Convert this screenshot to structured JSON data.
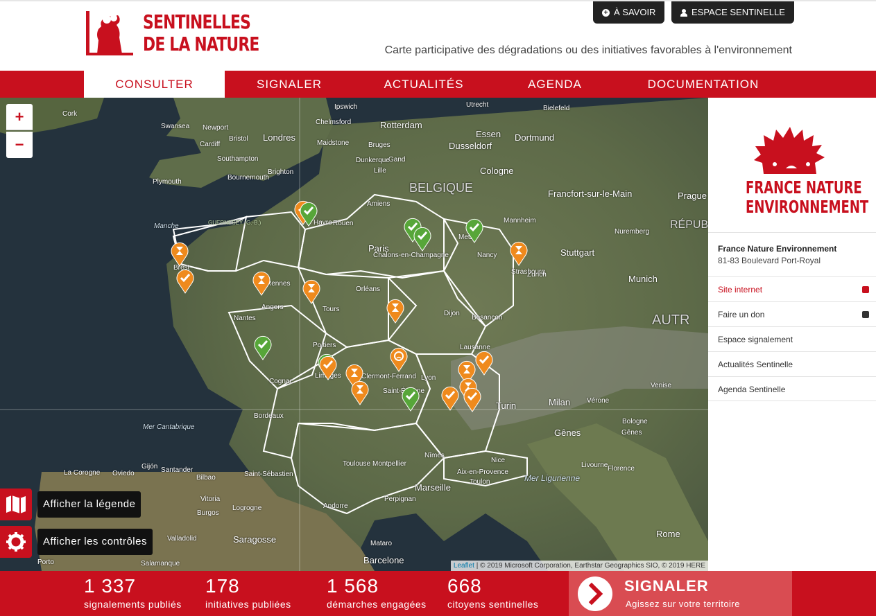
{
  "header": {
    "logo_line1": "SENTINELLES",
    "logo_line2": "DE LA NATURE",
    "btn_about": "À SAVOIR",
    "btn_space": "ESPACE SENTINELLE",
    "tagline": "Carte participative des dégradations ou des initiatives favorables à l'environnement"
  },
  "nav": {
    "items": [
      {
        "label": "CONSULTER"
      },
      {
        "label": "SIGNALER"
      },
      {
        "label": "ACTUALITÉS"
      },
      {
        "label": "AGENDA"
      },
      {
        "label": "DOCUMENTATION"
      }
    ]
  },
  "map": {
    "zoom_in": "+",
    "zoom_out": "−",
    "legend_btn": "Afficher la légende",
    "controls_btn": "Afficher les contrôles",
    "attribution_link": "Leaflet",
    "attribution_text": " | © 2019 Microsoft Corporation, Earthstar Geographics SIO, © 2019 HERE",
    "labels": [
      "Cork",
      "Swansea",
      "Newport",
      "Bristol",
      "Cardiff",
      "Londres",
      "Ipswich",
      "Chelmsford",
      "Maidstone",
      "Southampton",
      "Brighton",
      "Plymouth",
      "Bournemouth",
      "Rotterdam",
      "Utrecht",
      "Bruges",
      "Gand",
      "Lille",
      "Dusseldorf",
      "Essen",
      "Dortmund",
      "Cologne",
      "Bielefeld",
      "BELGIQUE",
      "Francfort-sur-le-Main",
      "Mannheim",
      "Stuttgart",
      "Nuremberg",
      "Munich",
      "Prague",
      "Manche",
      "Amiens",
      "Havre",
      "Rouen",
      "Paris",
      "Metz",
      "Nancy",
      "Strasbourg",
      "Brest",
      "Rennes",
      "Angers",
      "Tours",
      "Orléans",
      "Nantes",
      "Dijon",
      "Besançon",
      "Lausanne",
      "Zurich",
      "Poitiers",
      "Limoges",
      "Clermont-Ferrand",
      "Lyon",
      "Saint-Étienne",
      "Cognac",
      "Bordeaux",
      "Turin",
      "Milan",
      "Gênes",
      "Toulouse",
      "Montpellier",
      "Nîmes",
      "Nice",
      "Marseille",
      "Toulon",
      "Aix-en-Provence",
      "Perpignan",
      "Bilbao",
      "Saint-Sébastien",
      "Santander",
      "Oviedo",
      "Gijón",
      "La Corogne",
      "Vitoria",
      "Burgos",
      "Logrogne",
      "Saragosse",
      "Valladolid",
      "Salamanque",
      "Barcelone",
      "Porto",
      "Mer Cantabrique",
      "Mer Ligurienne",
      "Florence",
      "Bologne",
      "Rome",
      "GUERNESEY (G.-B.)",
      "Chalons-en-Champagne",
      "Dunkerque",
      "AUTR",
      "RÉPUB",
      "Venise",
      "Vérone",
      "Gênes",
      "Livourne",
      "Mataro",
      "Andorre"
    ]
  },
  "sidebar": {
    "logo_line1": "FRANCE NATURE",
    "logo_line2": "ENVIRONNEMENT",
    "org_name": "France Nature Environnement",
    "org_address": "81-83 Boulevard Port-Royal",
    "links": [
      {
        "label": "Site internet"
      },
      {
        "label": "Faire un don"
      },
      {
        "label": "Espace signalement"
      },
      {
        "label": "Actualités Sentinelle"
      },
      {
        "label": "Agenda Sentinelle"
      }
    ]
  },
  "footer": {
    "stats": [
      {
        "value": "1 337",
        "label": "signalements publiés"
      },
      {
        "value": "178",
        "label": "initiatives publiées"
      },
      {
        "value": "1 568",
        "label": "démarches engagées"
      },
      {
        "value": "668",
        "label": "citoyens sentinelles"
      }
    ],
    "cta_title": "SIGNALER",
    "cta_subtitle": "Agissez sur votre territoire"
  },
  "colors": {
    "brand_red": "#c8101e",
    "marker_orange": "#ef8a1d",
    "marker_green": "#57a639"
  }
}
